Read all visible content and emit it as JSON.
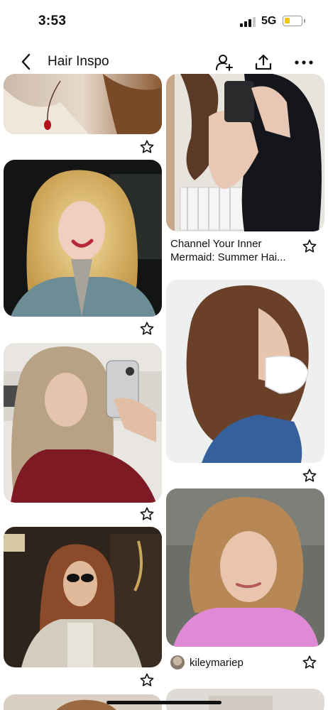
{
  "status_bar": {
    "time": "3:53",
    "network": "5G",
    "battery_level": 0.3,
    "battery_color": "#f4c400"
  },
  "header": {
    "title": "Hair Inspo",
    "back_icon": "chevron-left-icon",
    "collaborator_icon": "add-collaborator-icon",
    "share_icon": "share-icon",
    "more_icon": "more-icon"
  },
  "pins": {
    "left": [
      {
        "name": "pin-left-1",
        "alt": "Close-up of red pendant necklace and wavy hair"
      },
      {
        "name": "pin-left-2",
        "alt": "Woman with long curly blonde hair smiling"
      },
      {
        "name": "pin-left-3",
        "alt": "Mirror selfie with long curly highlighted hair"
      },
      {
        "name": "pin-left-4",
        "alt": "Woman with curly auburn hair and sunglasses"
      },
      {
        "name": "pin-left-5",
        "alt": "Curly hair"
      }
    ],
    "right": [
      {
        "name": "pin-right-1",
        "title": "Channel Your Inner Mermaid: Summer Hai..."
      },
      {
        "name": "pin-right-2",
        "alt": "Brown wavy shoulder-length hair with bangs, side view"
      },
      {
        "name": "pin-right-3",
        "user": "kileymariep"
      },
      {
        "name": "pin-right-4",
        "alt": "Pin image"
      }
    ]
  },
  "star_icon": "star-outline-icon"
}
